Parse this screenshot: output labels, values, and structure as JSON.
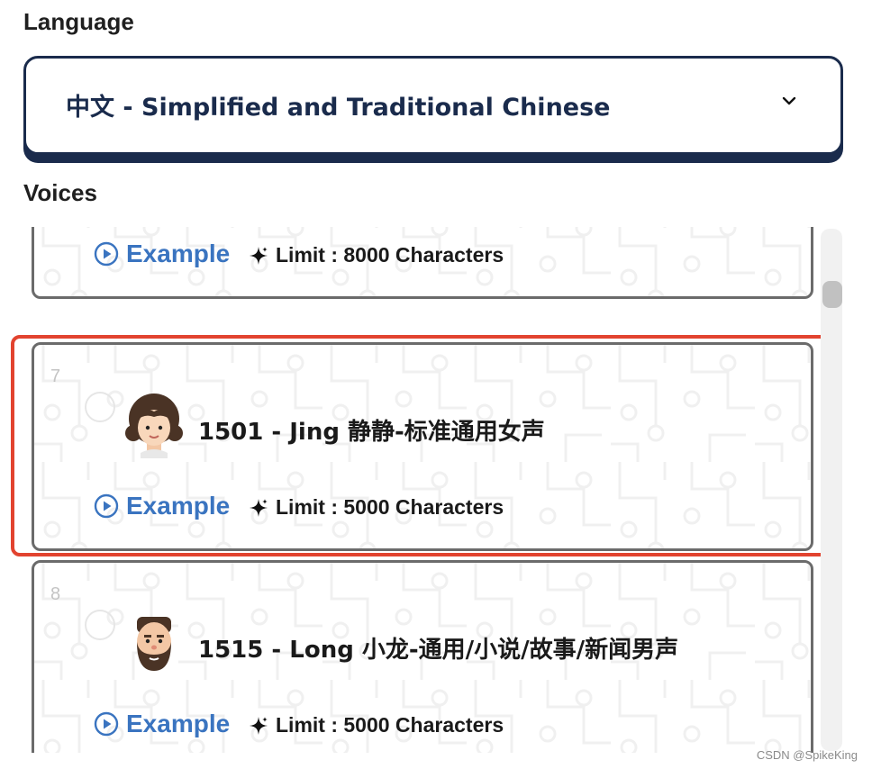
{
  "language": {
    "title": "Language",
    "selected": "中文 - Simplified and Traditional Chinese",
    "dropdown_icon": "chevron-down-icon"
  },
  "voices": {
    "title": "Voices",
    "items": [
      {
        "index": "",
        "name": "",
        "example_label": "Example",
        "limit_label": "Limit : 8000 Characters"
      },
      {
        "index": "7",
        "name": "1501 - Jing 静静-标准通用女声",
        "example_label": "Example",
        "limit_label": "Limit : 5000 Characters",
        "selected": true
      },
      {
        "index": "8",
        "name": "1515 - Long 小龙-通用/小说/故事/新闻男声",
        "example_label": "Example",
        "limit_label": "Limit : 5000 Characters"
      }
    ]
  },
  "colors": {
    "navy": "#1a2b4c",
    "link_blue": "#3a74c0",
    "selection_red": "#e2432f"
  },
  "watermark": "CSDN @SpikeKing"
}
